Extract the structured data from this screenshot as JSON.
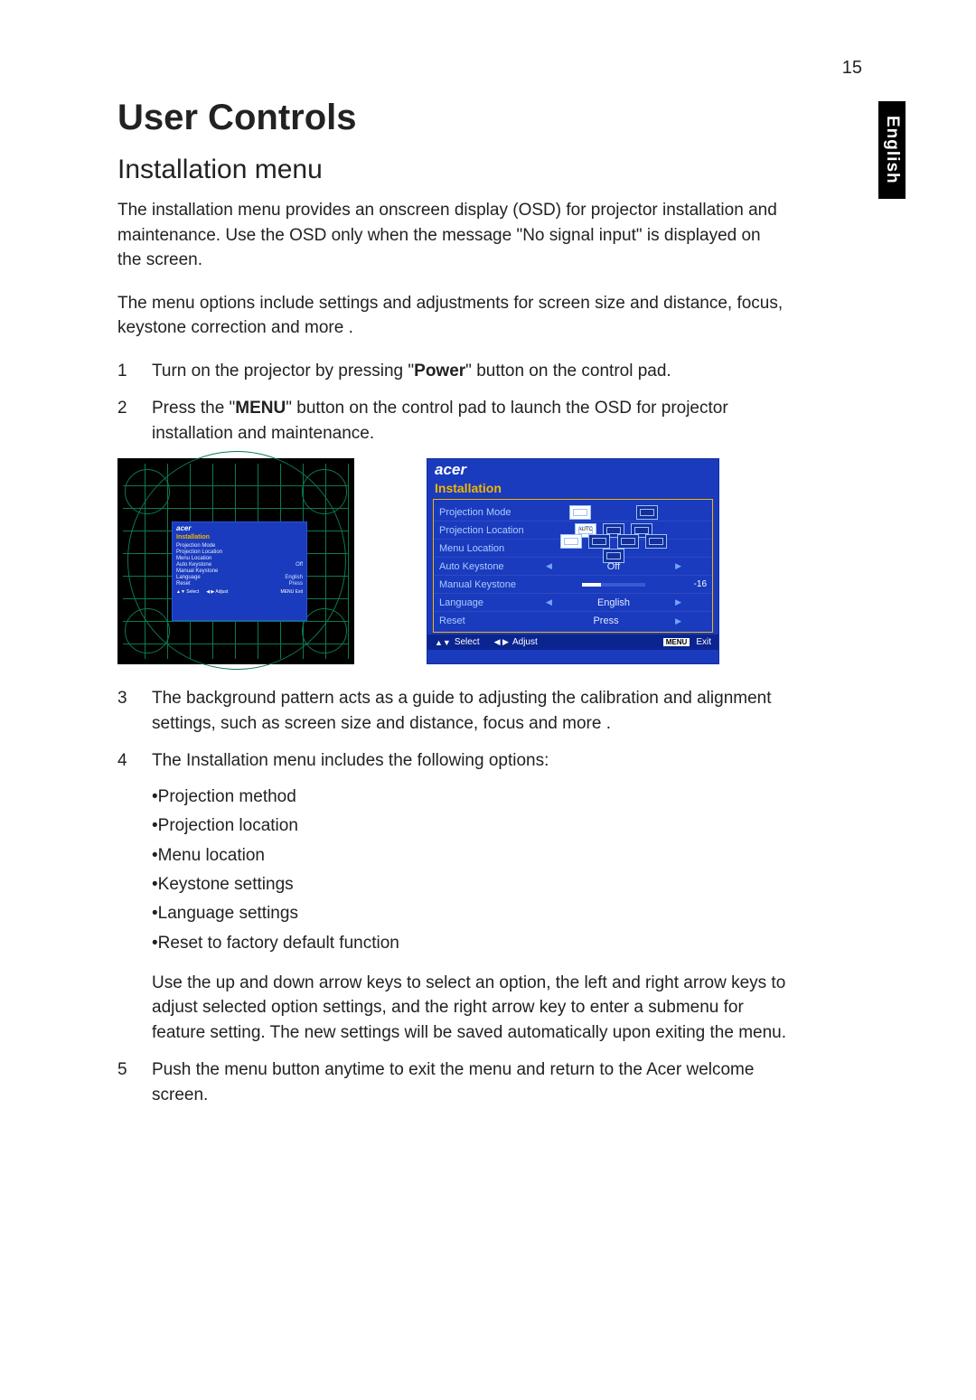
{
  "page": {
    "number": "15",
    "lang_tab": "English",
    "h1": "User Controls",
    "h2": "Installation menu",
    "intro1": "The installation menu provides an onscreen display (OSD) for projector installation and maintenance. Use the OSD only when the message \"No signal input\" is displayed on the screen.",
    "intro2": "The menu options include settings and adjustments for screen size and distance, focus, keystone correction and more .",
    "steps": {
      "s1": "Turn on the projector by pressing \"",
      "s1_bold": "Power",
      "s1_tail": "\" button on the control pad.",
      "s2": "Press the \"",
      "s2_bold": "MENU",
      "s2_tail": "\" button on the control pad to launch the OSD for projector installation and maintenance.",
      "s3": "The background pattern acts as a guide to adjusting the calibration and alignment settings, such as screen size and distance, focus and more .",
      "s4": "The Installation menu includes the following options:",
      "bullets": [
        "•Projection method",
        "•Projection location",
        "•Menu location",
        "•Keystone settings",
        "•Language settings",
        "•Reset to factory default function"
      ],
      "s4_para": "Use the up and down arrow keys to select an option, the left and right arrow keys to adjust selected option settings, and the right arrow key to enter a submenu for feature setting. The new settings will be saved automatically upon exiting the menu.",
      "s5": "Push the menu button anytime to exit the menu and return to the Acer welcome screen."
    }
  },
  "osd": {
    "brand": "acer",
    "title": "Installation",
    "rows": {
      "proj_mode": {
        "label": "Projection Mode"
      },
      "proj_loc": {
        "label": "Projection Location",
        "badge": "AUTO"
      },
      "menu_loc": {
        "label": "Menu Location"
      },
      "auto_keystone": {
        "label": "Auto Keystone",
        "value": "Off"
      },
      "man_keystone": {
        "label": "Manual Keystone",
        "tail": "-16"
      },
      "language": {
        "label": "Language",
        "value": "English"
      },
      "reset": {
        "label": "Reset",
        "value": "Press"
      }
    },
    "footer": {
      "select": "Select",
      "adjust": "Adjust",
      "menu_btn": "MENU",
      "exit": "Exit"
    }
  },
  "mini_osd": {
    "brand": "acer",
    "title": "Installation",
    "rows": [
      [
        "Projection Mode",
        ""
      ],
      [
        "Projection Location",
        ""
      ],
      [
        "Menu Location",
        ""
      ],
      [
        "Auto Keystone",
        "Off"
      ],
      [
        "Manual Keystone",
        ""
      ],
      [
        "Language",
        "English"
      ],
      [
        "Reset",
        "Press"
      ]
    ],
    "foot_select": "▲▼ Select",
    "foot_adjust": "◀ ▶  Adjust",
    "foot_exit": "MENU Exit"
  }
}
